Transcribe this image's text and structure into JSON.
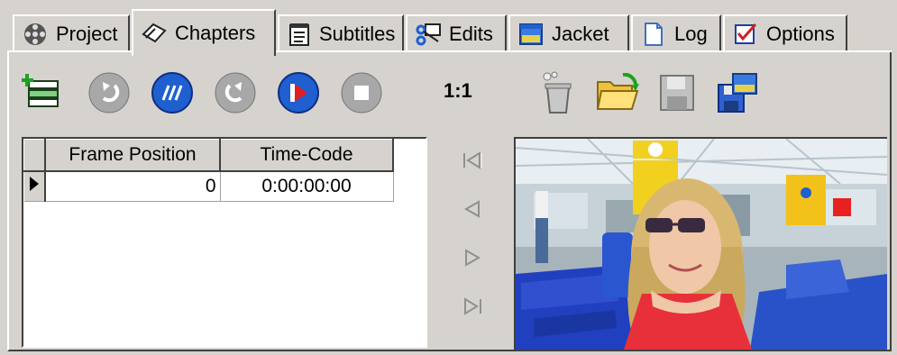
{
  "tabs": [
    {
      "label": "Project",
      "icon": "film-reel-icon",
      "active": false
    },
    {
      "label": "Chapters",
      "icon": "bookmark-icon",
      "active": true
    },
    {
      "label": "Subtitles",
      "icon": "notepad-icon",
      "active": false
    },
    {
      "label": "Edits",
      "icon": "scissors-clip-icon",
      "active": false
    },
    {
      "label": "Jacket",
      "icon": "picture-icon",
      "active": false
    },
    {
      "label": "Log",
      "icon": "document-icon",
      "active": false
    },
    {
      "label": "Options",
      "icon": "checkbox-icon",
      "active": false
    }
  ],
  "toolbar": {
    "add_chapter": "add-chapter-icon",
    "undo": "undo-icon",
    "split": "split-icon",
    "redo": "redo-icon",
    "play": "play-icon",
    "stop": "stop-icon",
    "ratio_label": "1:1",
    "delete": "trash-icon",
    "open": "open-folder-icon",
    "save": "save-icon",
    "save_as": "save-as-icon"
  },
  "grid": {
    "columns": [
      "Frame Position",
      "Time-Code"
    ],
    "rows": [
      {
        "frame": "0",
        "timecode": "0:00:00:00"
      }
    ]
  },
  "nav": [
    "first-frame-icon",
    "previous-frame-icon",
    "next-frame-icon",
    "last-frame-icon"
  ],
  "colors": {
    "face": "#d6d3ce",
    "accent_blue": "#1f5fd0",
    "green": "#2e9b3a"
  }
}
